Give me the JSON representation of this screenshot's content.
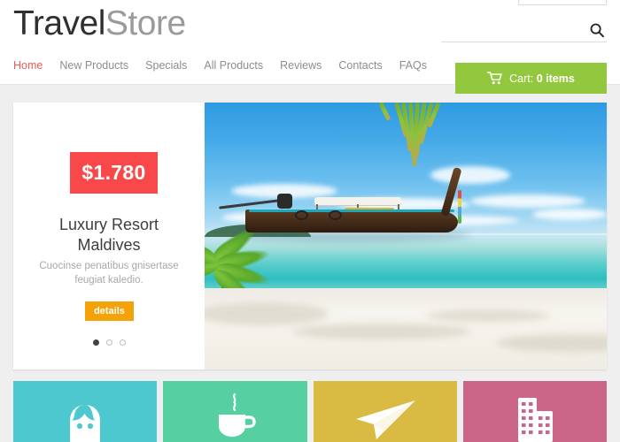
{
  "site": {
    "logo_primary": "Travel",
    "logo_secondary": "Store"
  },
  "header": {
    "search": {
      "value": "",
      "placeholder": "",
      "icon": "search-icon"
    },
    "cart": {
      "icon": "cart-icon",
      "label": "Cart:",
      "count_label": "0 items"
    }
  },
  "nav": {
    "items": [
      {
        "label": "Home",
        "active": true
      },
      {
        "label": "New Products",
        "active": false
      },
      {
        "label": "Specials",
        "active": false
      },
      {
        "label": "All Products",
        "active": false
      },
      {
        "label": "Reviews",
        "active": false
      },
      {
        "label": "Contacts",
        "active": false
      },
      {
        "label": "FAQs",
        "active": false
      }
    ]
  },
  "hero": {
    "price": "$1.780",
    "title_line1": "Luxury Resort",
    "title_line2": "Maldives",
    "subtitle": "Cuocinse penatibus gnisertase feugiat kaledio.",
    "button_label": "details",
    "slides_total": 3,
    "active_slide": 1,
    "image_alt": "Tropical beach with longtail boat and palm tree"
  },
  "tiles": [
    {
      "icon": "person-icon",
      "color": "#4ec8cf"
    },
    {
      "icon": "coffee-cup-icon",
      "color": "#56cfa1"
    },
    {
      "icon": "paper-plane-icon",
      "color": "#d9bb44"
    },
    {
      "icon": "buildings-icon",
      "color": "#cb6689"
    }
  ],
  "colors": {
    "accent_red": "#f05a5a",
    "price_badge": "#f9484a",
    "details_button": "#f5a208",
    "cart_green": "#93c83e",
    "page_background": "#efefef"
  }
}
